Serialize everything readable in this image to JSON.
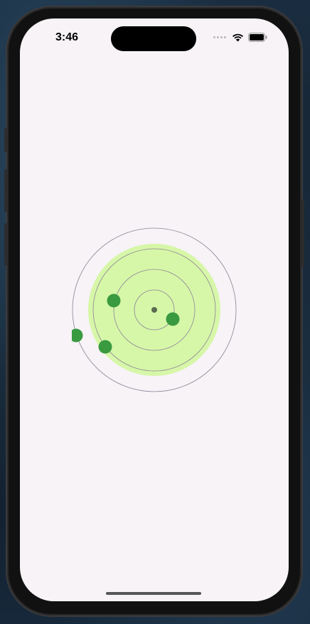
{
  "status_bar": {
    "time": "3:46",
    "icons": [
      "signal-dots-icon",
      "wifi-icon",
      "battery-icon"
    ]
  },
  "radar": {
    "colors": {
      "zone_fill": "#d6f7a8",
      "ring_stroke": "#8c8296",
      "center_dot": "#5a6c50",
      "marker_fill": "#3a9a40"
    },
    "markers": 4
  },
  "home_indicator": "home-indicator"
}
